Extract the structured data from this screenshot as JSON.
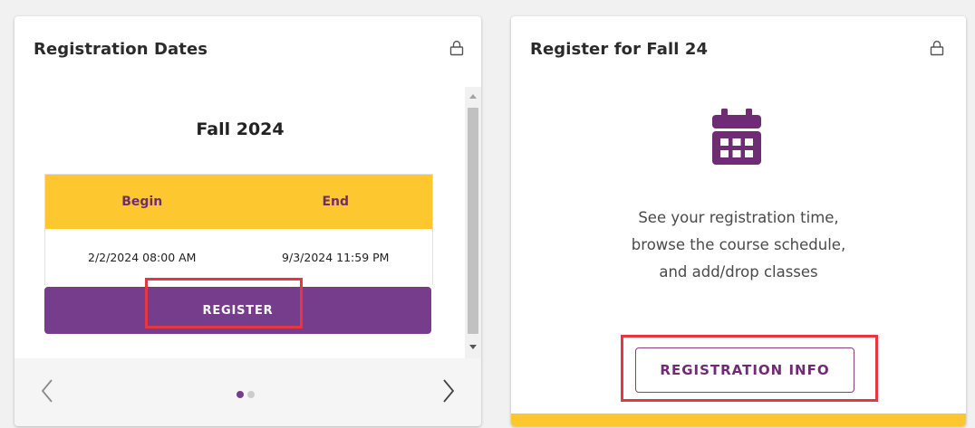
{
  "colors": {
    "accent_gold": "#fdc72f",
    "brand_purple": "#763d8c",
    "highlight_red": "#e8353f"
  },
  "registration_dates_card": {
    "title": "Registration Dates",
    "term": "Fall 2024",
    "table": {
      "headers": [
        "Begin",
        "End"
      ],
      "rows": [
        [
          "2/2/2024 08:00 AM",
          "9/3/2024 11:59 PM"
        ]
      ]
    },
    "register_label": "REGISTER",
    "pagination": {
      "current_page": 1,
      "total_pages": 2
    },
    "icons": [
      "lock-icon",
      "chevron-left-icon",
      "chevron-right-icon"
    ]
  },
  "register_fall_card": {
    "title": "Register for Fall 24",
    "description_lines": [
      "See your registration time,",
      "browse the course schedule,",
      "and add/drop classes"
    ],
    "info_button_label": "REGISTRATION INFO",
    "icons": [
      "lock-icon",
      "calendar-icon"
    ]
  }
}
